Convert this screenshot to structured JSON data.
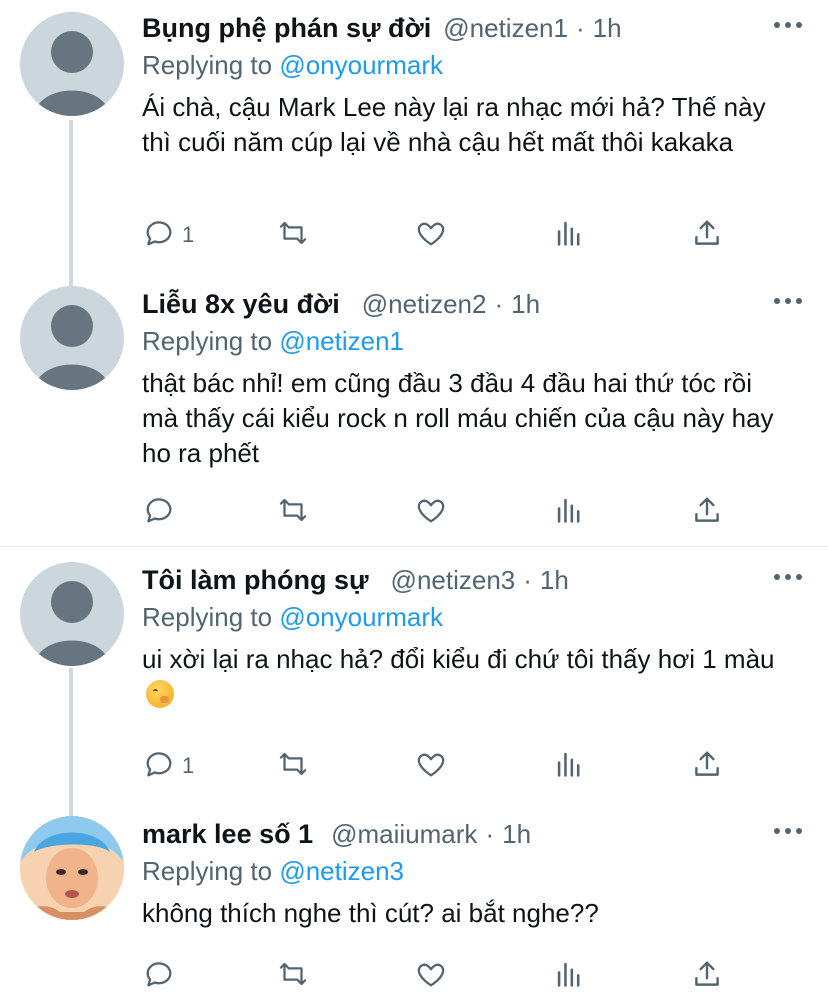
{
  "tweets": [
    {
      "name": "Bụng phệ phán sự đời",
      "handle": "@netizen1",
      "sep": "·",
      "time": "1h",
      "replying_label": "Replying to",
      "replying_to": "@onyourmark",
      "text": "Ái chà, cậu Mark Lee này lại ra nhạc mới hả? Thế này thì cuối năm cúp lại về nhà cậu hết mất thôi kakaka",
      "reply_count": "1"
    },
    {
      "name": "Liễu 8x yêu đời",
      "handle": "@netizen2",
      "sep": "·",
      "time": "1h",
      "replying_label": "Replying to",
      "replying_to": "@netizen1",
      "text": "thật bác nhỉ! em cũng đầu 3 đầu 4 đầu hai thứ tóc rồi mà thấy cái kiểu rock n roll máu chiến của cậu này hay ho ra phết",
      "reply_count": ""
    },
    {
      "name": "Tôi làm phóng sự",
      "handle": "@netizen3",
      "sep": "·",
      "time": "1h",
      "replying_label": "Replying to",
      "replying_to": "@onyourmark",
      "text": "ui xời lại ra nhạc hả? đổi kiểu đi chứ tôi thấy hơi 1 màu",
      "emoji": "yawning-face",
      "reply_count": "1"
    },
    {
      "name": "mark lee số 1",
      "handle": "@maiiumark",
      "sep": "·",
      "time": "1h",
      "replying_label": "Replying to",
      "replying_to": "@netizen3",
      "text": "không thích nghe thì cút? ai bắt nghe??",
      "reply_count": ""
    }
  ],
  "icons": [
    "reply-icon",
    "retweet-icon",
    "like-icon",
    "analytics-icon",
    "share-icon",
    "more-icon",
    "default-avatar-icon"
  ],
  "colors": {
    "accent": "#1d9bf0",
    "secondary_text": "#536471",
    "primary_text": "#0f1419",
    "avatar_bg": "#ccd6dd",
    "thread_line": "#cfd9de"
  }
}
